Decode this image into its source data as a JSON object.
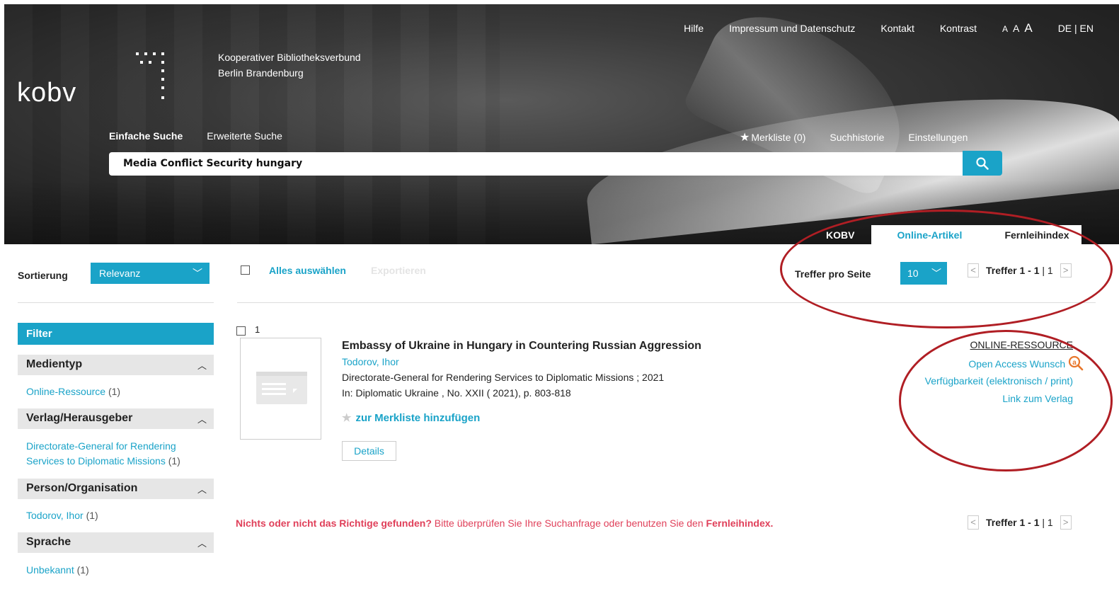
{
  "brand": {
    "logo_text": "kobv",
    "org_line1": "Kooperativer Bibliotheksverbund",
    "org_line2": "Berlin Brandenburg"
  },
  "toplinks": {
    "help": "Hilfe",
    "imprint": "Impressum und Datenschutz",
    "contact": "Kontakt",
    "contrast": "Kontrast",
    "font_small": "A",
    "font_medium": "A",
    "font_large": "A",
    "lang": "DE | EN"
  },
  "searchnav": {
    "simple": "Einfache Suche",
    "advanced": "Erweiterte Suche"
  },
  "usernav": {
    "merkliste": "Merkliste (0)",
    "history": "Suchhistorie",
    "settings": "Einstellungen"
  },
  "search": {
    "query": "Media Conflict Security hungary"
  },
  "tabs": [
    "KOBV",
    "Online-Artikel",
    "Fernleihindex"
  ],
  "toolbar": {
    "sort_label": "Sortierung",
    "sort_value": "Relevanz",
    "select_all": "Alles auswählen",
    "export": "Exportieren",
    "per_page_label": "Treffer pro Seite",
    "per_page_value": "10",
    "hits_label": "Treffer 1 - 1",
    "hits_pages": "| 1"
  },
  "sidebar": {
    "filter": "Filter",
    "facets": [
      {
        "label": "Medientyp",
        "items": [
          {
            "name": "Online-Ressource",
            "count": "(1)"
          }
        ]
      },
      {
        "label": "Verlag/Herausgeber",
        "items": [
          {
            "name": "Directorate-General for Rendering Services to Diplomatic Missions",
            "count": "(1)"
          }
        ]
      },
      {
        "label": "Person/Organisation",
        "items": [
          {
            "name": "Todorov, Ihor",
            "count": "(1)"
          }
        ]
      },
      {
        "label": "Sprache",
        "items": [
          {
            "name": "Unbekannt",
            "count": "(1)"
          }
        ]
      }
    ]
  },
  "result": {
    "number": "1",
    "title": "Embassy of Ukraine in Hungary in Countering Russian Aggression",
    "author": "Todorov, Ihor",
    "publisher": "Directorate-General for Rendering Services to Diplomatic Missions ; 2021",
    "in": "In:  Diplomatic Ukraine , No. XXII ( 2021), p. 803-818",
    "merkliste": "zur Merkliste hinzufügen",
    "details": "Details",
    "type": "ONLINE-RESSOURCE",
    "open_access": "Open Access Wunsch",
    "availability": "Verfügbarkeit (elektronisch / print)",
    "publisher_link": "Link zum Verlag"
  },
  "footer": {
    "nothing_bold": "Nichts oder nicht das Richtige gefunden?",
    "nothing_text": " Bitte überprüfen Sie Ihre Suchanfrage oder benutzen Sie den ",
    "fernleih": "Fernleihindex."
  },
  "colors": {
    "accent": "#1aa3c8",
    "annotation": "#b01e24",
    "warning": "#e0405a"
  }
}
